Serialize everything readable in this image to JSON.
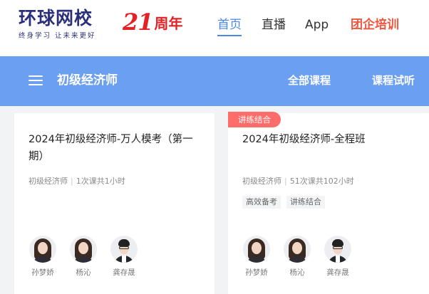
{
  "header": {
    "logo_main": "环球网校",
    "logo_sub": "终身学习 让未来更好",
    "anniversary_number": "21",
    "anniversary_text": "周年",
    "nav": {
      "home": "首页",
      "live": "直播",
      "app": "App",
      "corporate": "团企培训"
    },
    "active_nav": "首页",
    "colors": {
      "accent": "#4a87e8",
      "brand": "#2b2f7b",
      "anniversary": "#e32226",
      "corporate": "#f2553d"
    }
  },
  "category_bar": {
    "title": "初级经济师",
    "all_courses": "全部课程",
    "trial": "课程试听",
    "background": "#6b9ff0"
  },
  "courses": [
    {
      "tag": "",
      "title": "2024年初级经济师-万人模考（第一期）",
      "category": "初级经济师",
      "sessions": "1次课共1小时",
      "chips": [],
      "teachers": [
        {
          "name": "孙梦娇",
          "avatar": "female-teacher-avatar"
        },
        {
          "name": "杨沁",
          "avatar": "female-teacher-avatar"
        },
        {
          "name": "龚存晟",
          "avatar": "male-teacher-avatar"
        }
      ]
    },
    {
      "tag": "讲练结合",
      "title": "2024年初级经济师-全程班",
      "category": "初级经济师",
      "sessions": "51次课共102小时",
      "chips": [
        "高效备考",
        "讲练结合"
      ],
      "teachers": [
        {
          "name": "孙梦娇",
          "avatar": "female-teacher-avatar"
        },
        {
          "name": "杨沁",
          "avatar": "female-teacher-avatar"
        },
        {
          "name": "龚存晟",
          "avatar": "male-teacher-avatar"
        }
      ]
    }
  ]
}
